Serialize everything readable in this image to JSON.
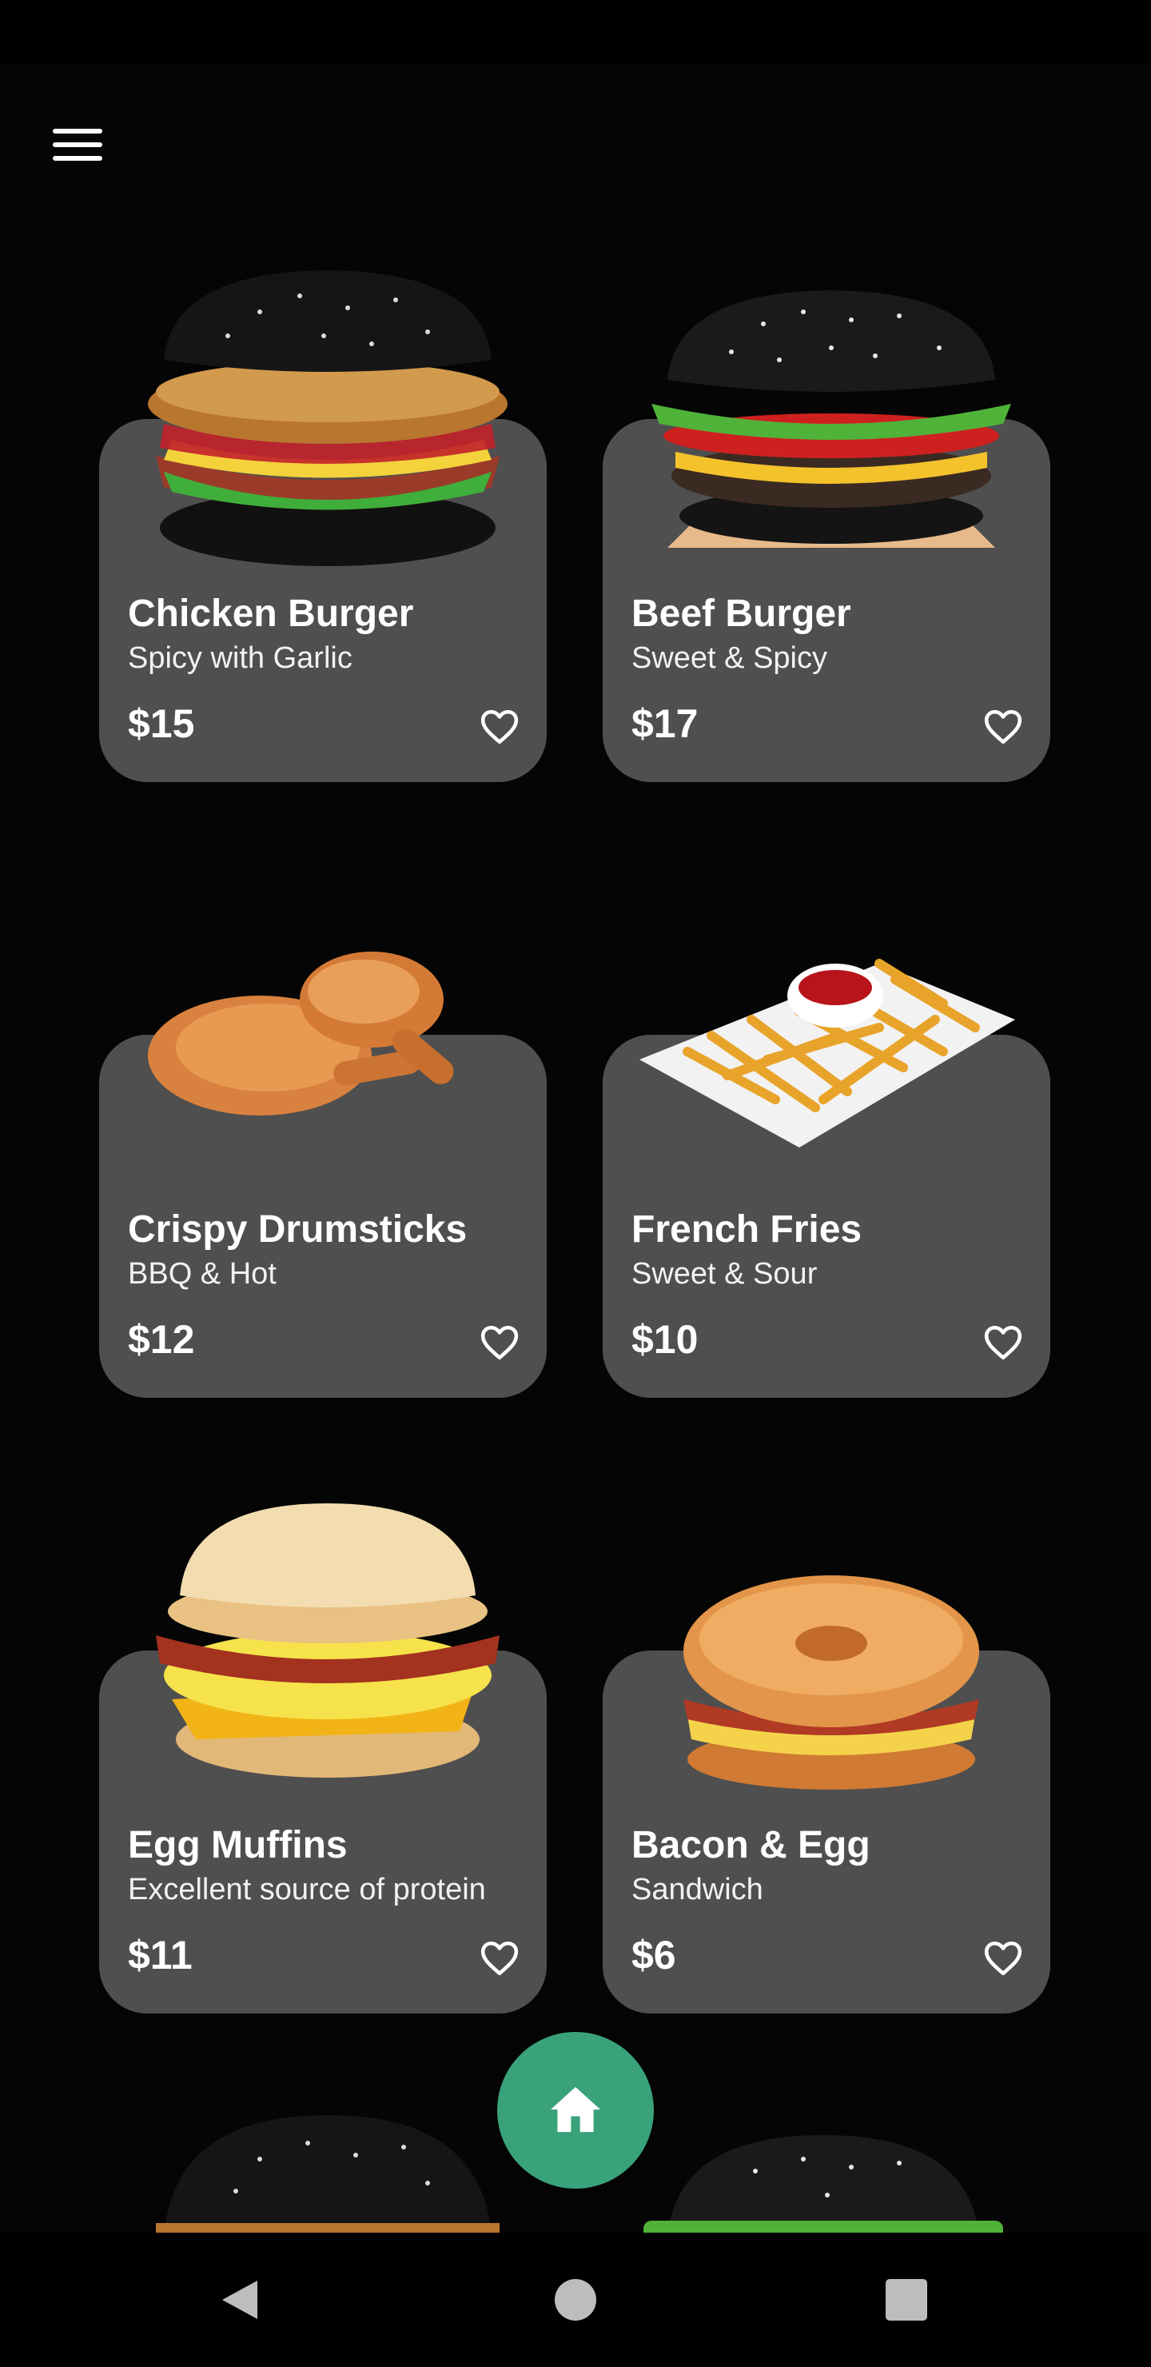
{
  "menu": {
    "icon": "hamburger-menu-icon"
  },
  "products": [
    {
      "name": "Chicken Burger",
      "description": "Spicy with Garlic",
      "price": "$15",
      "image": "chicken-burger-image"
    },
    {
      "name": "Beef Burger",
      "description": "Sweet & Spicy",
      "price": "$17",
      "image": "beef-burger-image"
    },
    {
      "name": "Crispy Drumsticks",
      "description": "BBQ & Hot",
      "price": "$12",
      "image": "drumsticks-image"
    },
    {
      "name": "French Fries",
      "description": "Sweet & Sour",
      "price": "$10",
      "image": "french-fries-image"
    },
    {
      "name": "Egg Muffins",
      "description": "Excellent source of protein",
      "price": "$11",
      "image": "egg-muffin-image"
    },
    {
      "name": "Bacon & Egg",
      "description": "Sandwich",
      "price": "$6",
      "image": "bagel-sandwich-image"
    }
  ],
  "favorite_icon": "heart-outline-icon",
  "fab": {
    "icon": "home-icon",
    "color": "#3aa27a"
  },
  "colors": {
    "background": "#050505",
    "card": "#4f4f4f",
    "accent": "#3aa27a"
  },
  "navigation": {
    "back_icon": "back-triangle-icon",
    "home_icon": "home-circle-icon",
    "recents_icon": "recents-square-icon"
  }
}
